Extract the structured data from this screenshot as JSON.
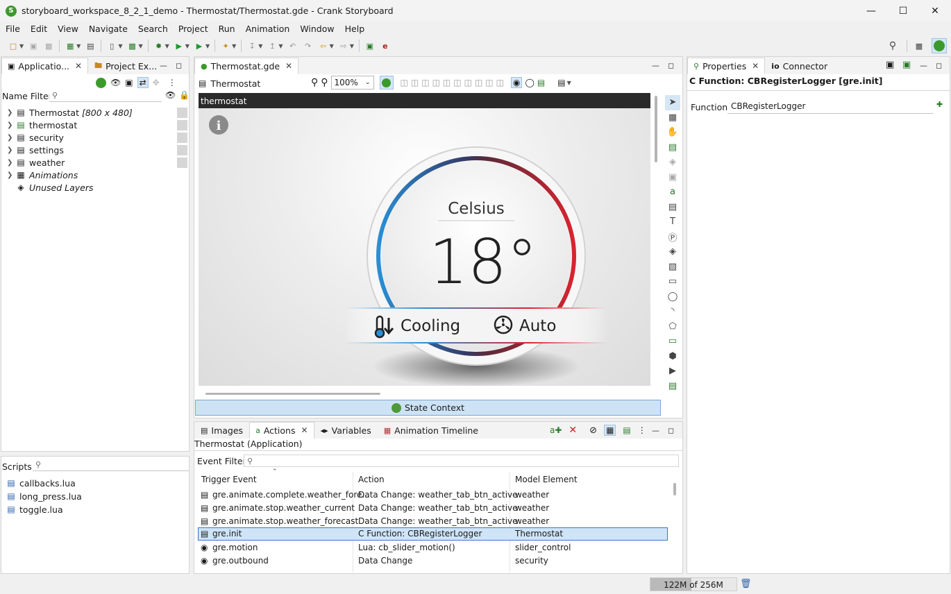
{
  "window": {
    "title": "storyboard_workspace_8_2_1_demo - Thermostat/Thermostat.gde - Crank Storyboard"
  },
  "menu": [
    "File",
    "Edit",
    "View",
    "Navigate",
    "Search",
    "Project",
    "Run",
    "Animation",
    "Window",
    "Help"
  ],
  "left_panel": {
    "tabs": [
      {
        "label": "Applicatio..."
      },
      {
        "label": "Project Ex..."
      }
    ],
    "name_filter_label": "Name Filter:",
    "tree": [
      {
        "label": "Thermostat",
        "suffix": "[800 x 480]",
        "italic": false
      },
      {
        "label": "thermostat",
        "italic": false
      },
      {
        "label": "security",
        "italic": false
      },
      {
        "label": "settings",
        "italic": false
      },
      {
        "label": "weather",
        "italic": false
      },
      {
        "label": "Animations",
        "italic": true
      },
      {
        "label": "Unused Layers",
        "italic": true
      }
    ],
    "scripts_label": "Scripts:",
    "scripts": [
      "callbacks.lua",
      "long_press.lua",
      "toggle.lua"
    ]
  },
  "editor": {
    "tab_label": "Thermostat.gde",
    "breadcrumb": "Thermostat",
    "zoom": "100%",
    "canvas_layer_label": "thermostat",
    "dial": {
      "unit": "Celsius",
      "temperature": "18°",
      "mode": "Cooling",
      "fan": "Auto",
      "info": "i"
    },
    "state_context_label": "State Context"
  },
  "properties_panel": {
    "tabs": [
      {
        "label": "Properties"
      },
      {
        "label": "Connector"
      }
    ],
    "heading": "C Function: CBRegisterLogger [gre.init]",
    "function_label": "Function",
    "function_value": "CBRegisterLogger"
  },
  "bottom_panel": {
    "tabs": [
      {
        "label": "Images"
      },
      {
        "label": "Actions"
      },
      {
        "label": "Variables"
      },
      {
        "label": "Animation Timeline"
      }
    ],
    "context_label": "Thermostat (Application)",
    "event_filter_label": "Event Filter:",
    "columns": [
      "Trigger Event",
      "Action",
      "Model Element"
    ],
    "rows": [
      {
        "trigger": "gre.animate.complete.weather_fore...",
        "action": "Data Change: weather_tab_btn_active",
        "element": "weather",
        "selected": false
      },
      {
        "trigger": "gre.animate.stop.weather_current",
        "action": "Data Change: weather_tab_btn_active",
        "element": "weather",
        "selected": false
      },
      {
        "trigger": "gre.animate.stop.weather_forecast",
        "action": "Data Change: weather_tab_btn_active",
        "element": "weather",
        "selected": false
      },
      {
        "trigger": "gre.init",
        "action": "C Function: CBRegisterLogger",
        "element": "Thermostat",
        "selected": true
      },
      {
        "trigger": "gre.motion",
        "action": "Lua: cb_slider_motion()",
        "element": "slider_control",
        "selected": false
      },
      {
        "trigger": "gre.outbound",
        "action": "Data Change",
        "element": "security",
        "selected": false
      }
    ]
  },
  "status": {
    "memory": "122M of 256M",
    "memory_used_fraction": 0.477
  },
  "colors": {
    "accent_blue": "#3875c9",
    "selection": "#cfe4f7",
    "state_context_bg": "#cde3f5",
    "dial_cold": "#2a8fd6",
    "dial_hot": "#d8242f"
  }
}
